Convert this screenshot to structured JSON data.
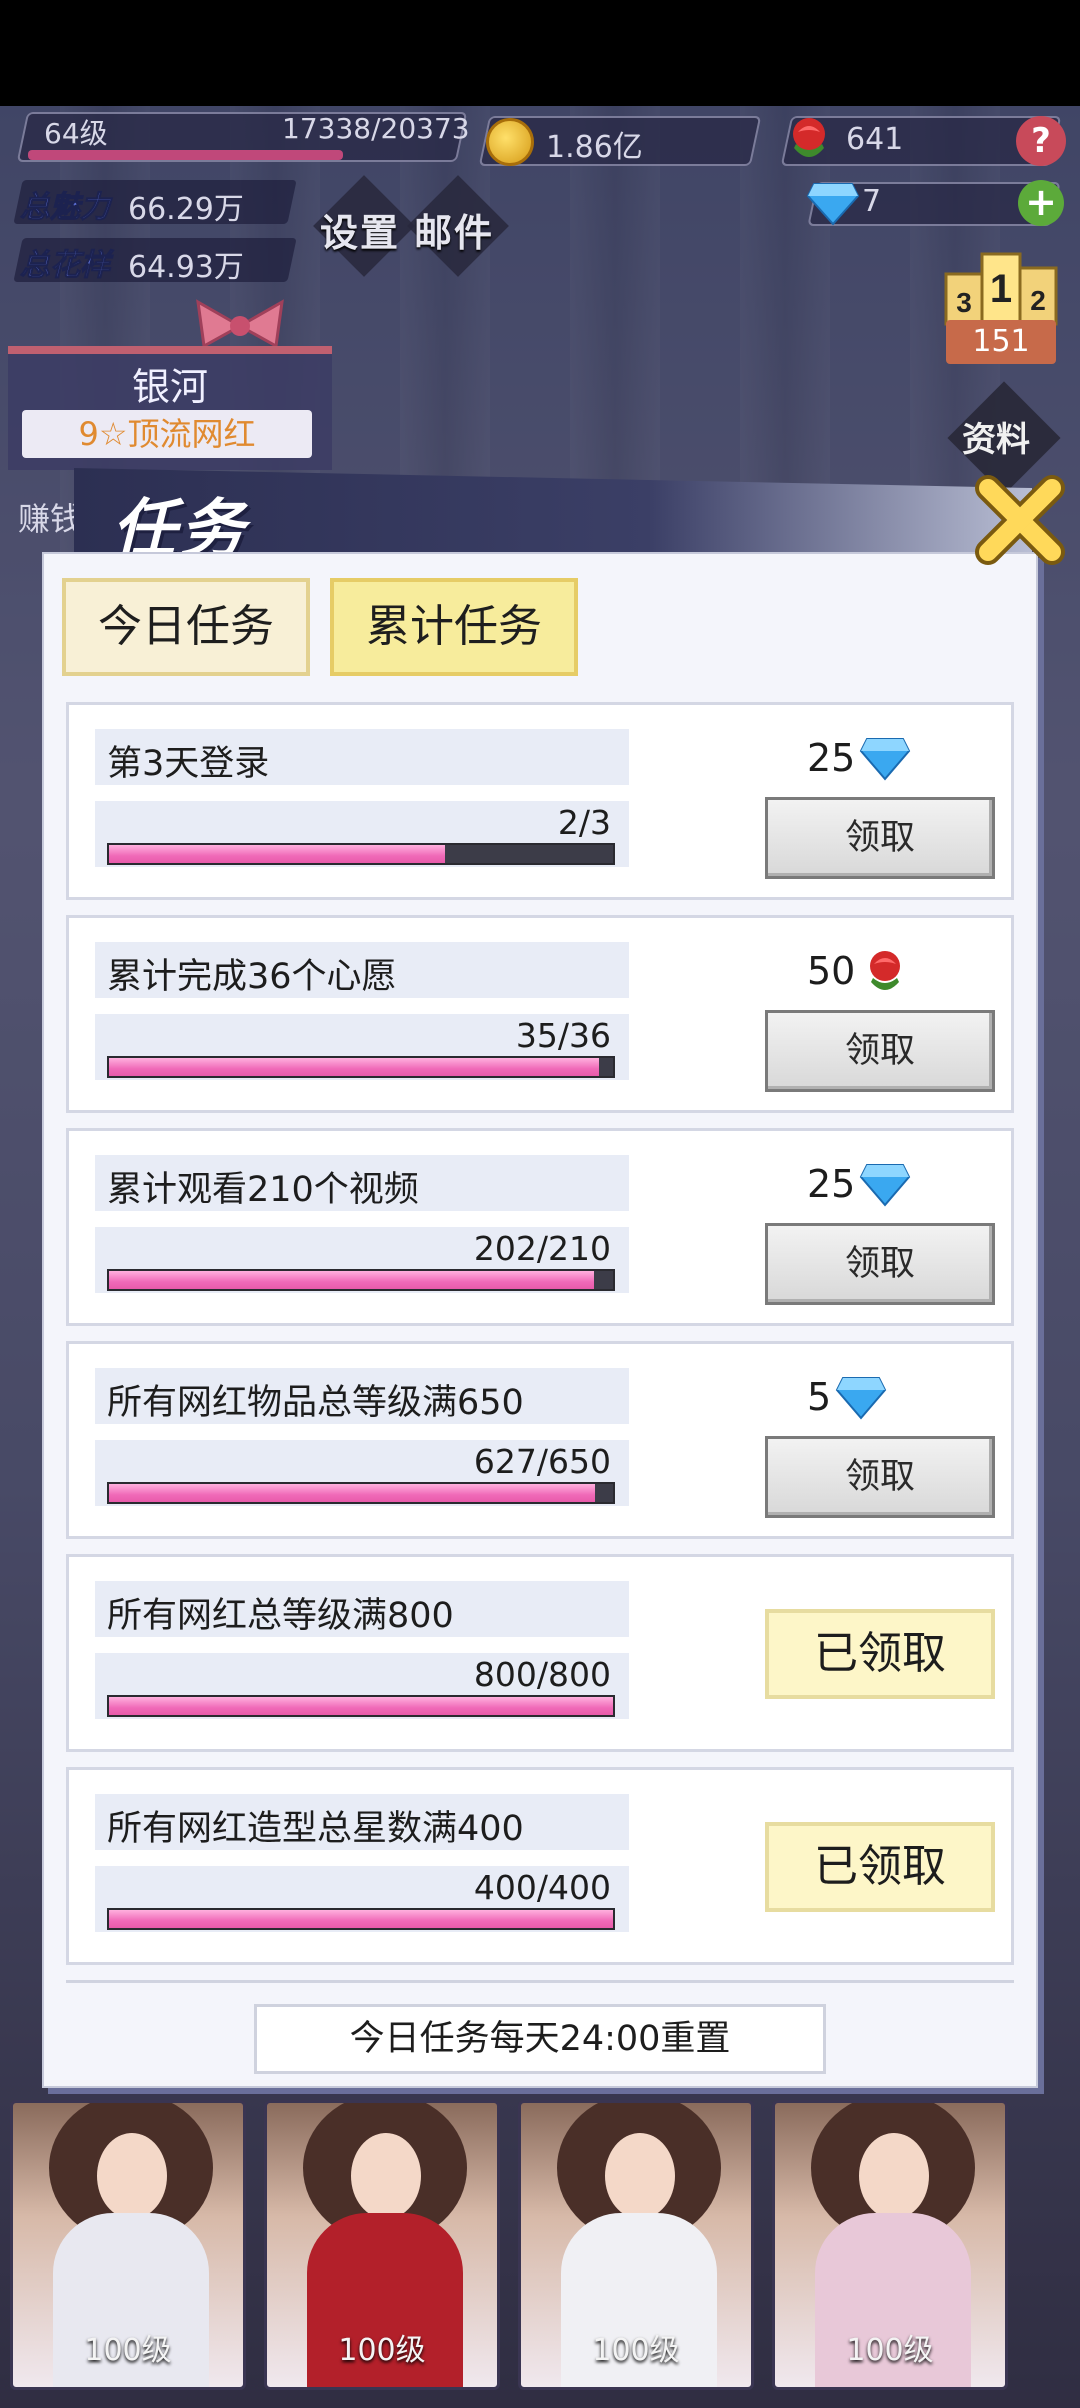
{
  "hud": {
    "level": "64级",
    "exp": "17338/20373",
    "exp_ratio": 0.851,
    "coins": "1.86亿",
    "roses": "641",
    "diamonds": "7",
    "charm_label": "总魅力",
    "charm_value": "66.29万",
    "style_label": "总花样",
    "style_value": "64.93万",
    "settings_label": "设置",
    "mail_label": "邮件",
    "ranking": {
      "rank_3": "3",
      "rank_1": "1",
      "rank_2": "2",
      "count": "151"
    },
    "info_label": "资料",
    "help_icon": "question-icon",
    "add_icon": "plus-icon"
  },
  "character": {
    "name": "银河",
    "rank": "9☆顶流网红",
    "side_text": "赚钱"
  },
  "dialog": {
    "title": "任务",
    "tabs": [
      {
        "label": "今日任务",
        "active": false
      },
      {
        "label": "累计任务",
        "active": true
      }
    ],
    "tasks": [
      {
        "title": "第3天登录",
        "progress": "2/3",
        "ratio": 0.667,
        "reward": "25",
        "reward_icon": "diamond-icon",
        "button": "领取",
        "claimed": false
      },
      {
        "title": "累计完成36个心愿",
        "progress": "35/36",
        "ratio": 0.972,
        "reward": "50",
        "reward_icon": "rose-icon",
        "button": "领取",
        "claimed": false
      },
      {
        "title": "累计观看210个视频",
        "progress": "202/210",
        "ratio": 0.962,
        "reward": "25",
        "reward_icon": "diamond-icon",
        "button": "领取",
        "claimed": false
      },
      {
        "title": "所有网红物品总等级满650",
        "progress": "627/650",
        "ratio": 0.965,
        "reward": "5",
        "reward_icon": "diamond-icon",
        "button": "领取",
        "claimed": false
      },
      {
        "title": "所有网红总等级满800",
        "progress": "800/800",
        "ratio": 1.0,
        "reward": "",
        "reward_icon": "",
        "button": "已领取",
        "claimed": true
      },
      {
        "title": "所有网红造型总星数满400",
        "progress": "400/400",
        "ratio": 1.0,
        "reward": "",
        "reward_icon": "",
        "button": "已领取",
        "claimed": true
      }
    ],
    "reset_note": "今日任务每天24:00重置"
  },
  "portraits": [
    {
      "level": "100级",
      "dress_color": "#e8e8f0"
    },
    {
      "level": "100级",
      "dress_color": "#b3202a"
    },
    {
      "level": "100级",
      "dress_color": "#f0f0f4"
    },
    {
      "level": "100级",
      "dress_color": "#e8c8d8"
    }
  ],
  "colors": {
    "progress_fill": "#f06ab8",
    "diamond": "#3aa8f0",
    "rose": "#d02a2a",
    "claimed_bg": "#fdf6c8",
    "active_tab": "#f7ec9c"
  }
}
